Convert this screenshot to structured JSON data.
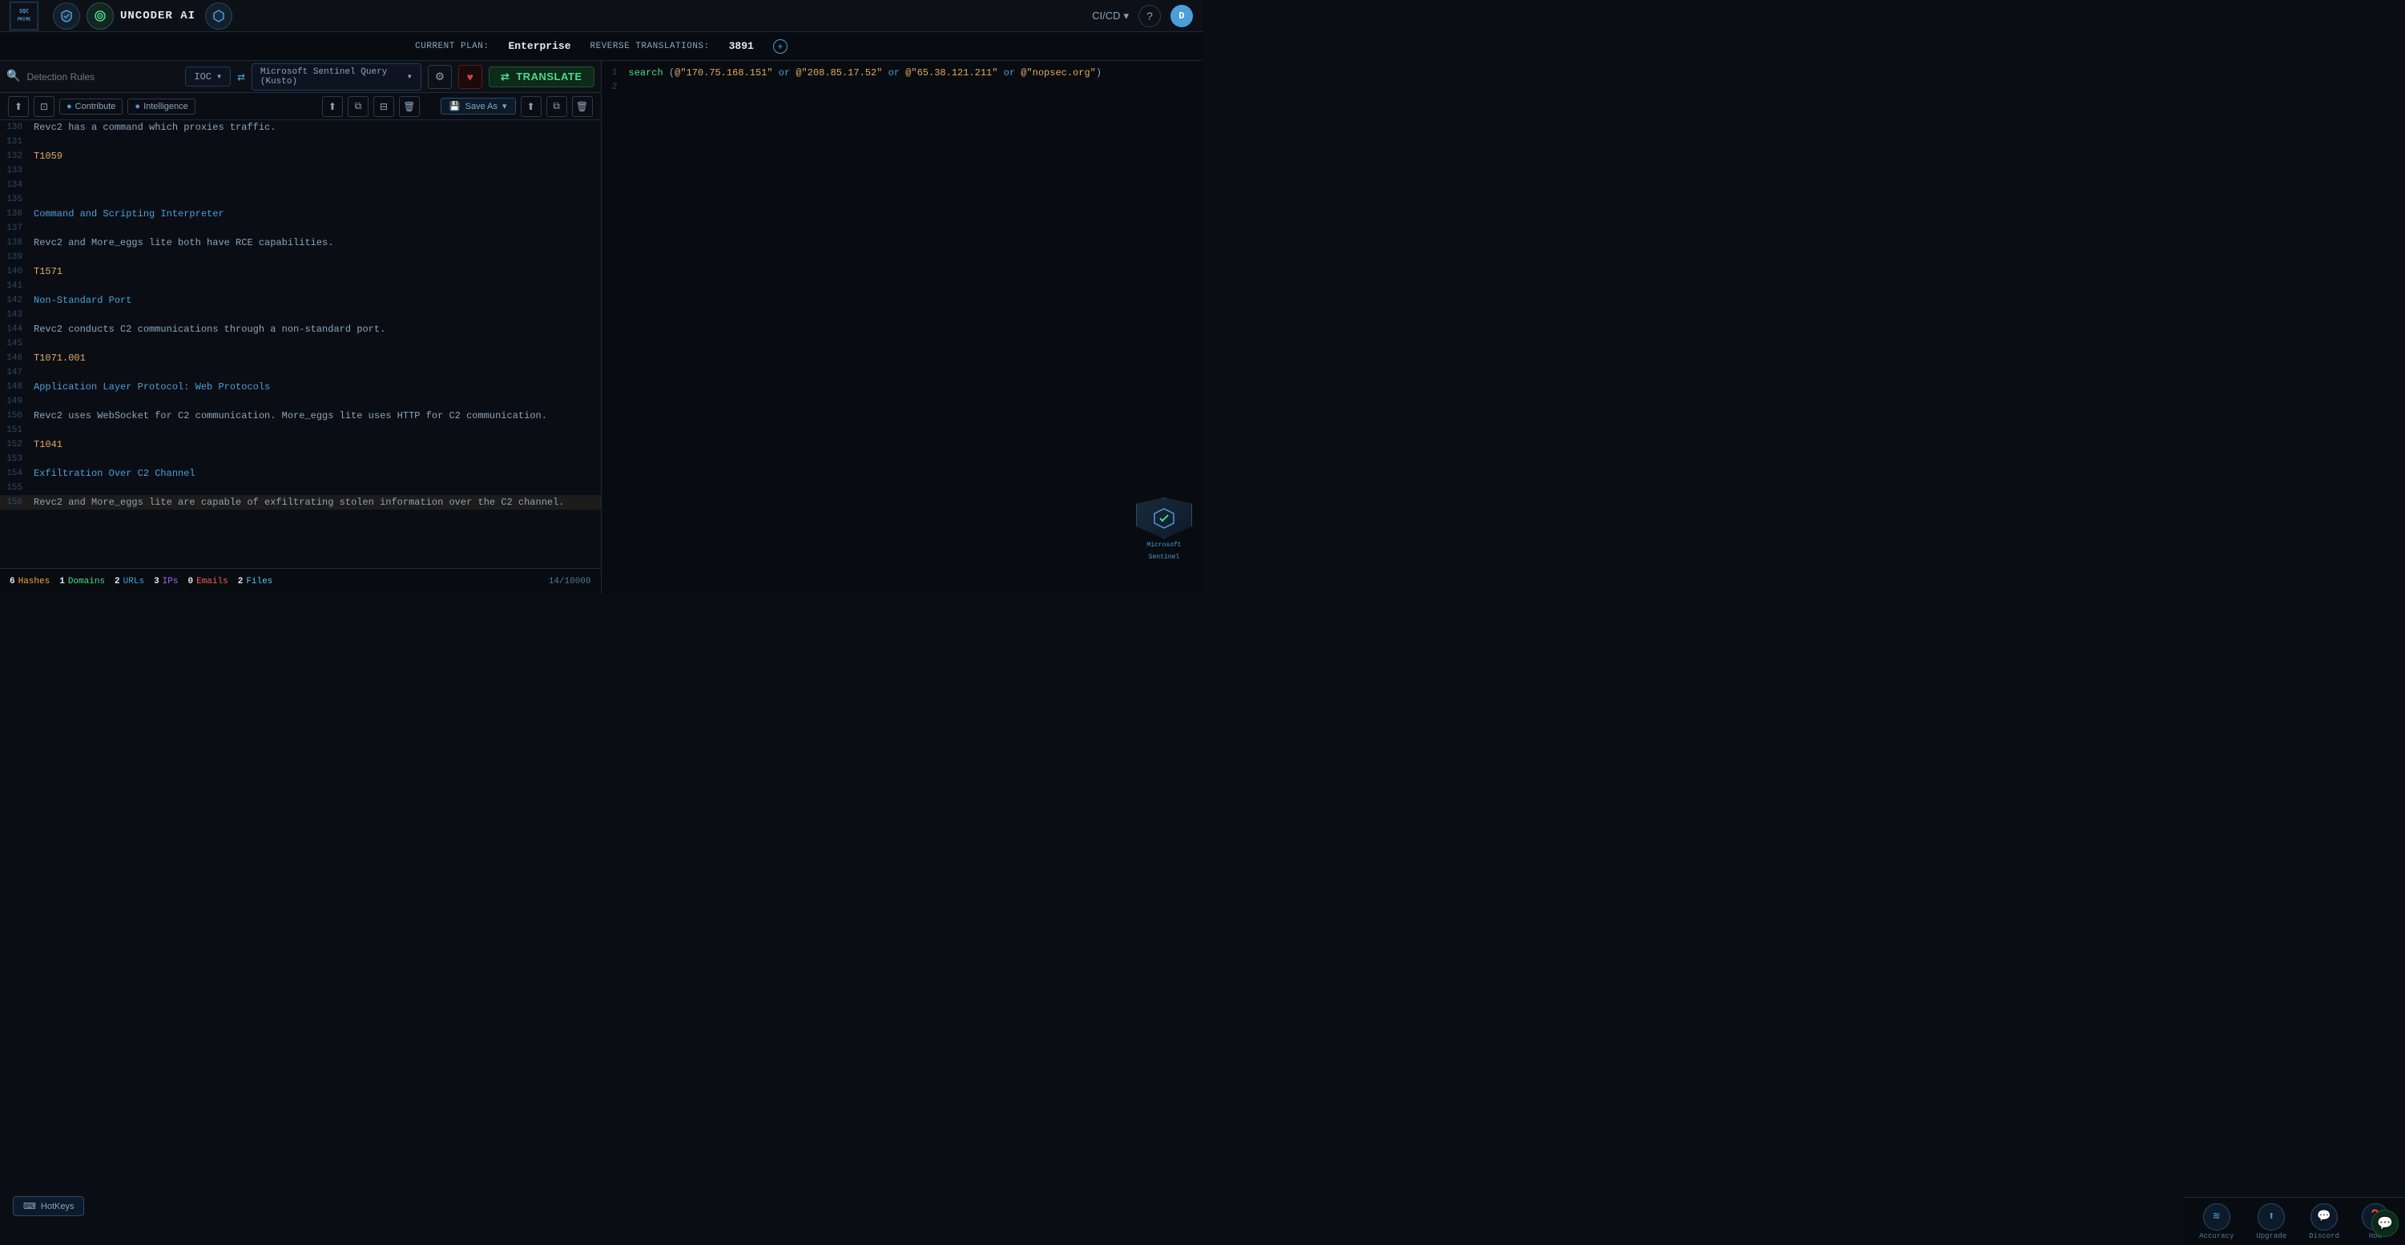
{
  "app": {
    "logo_text": "SQC\nPRIME",
    "title": "UNCODER AI"
  },
  "nav": {
    "cicd_label": "CI/CD",
    "help_icon": "?",
    "user_initial": "D"
  },
  "plan_bar": {
    "current_plan_label": "CURRENT PLAN:",
    "plan_value": "Enterprise",
    "reverse_label": "REVERSE TRANSLATIONS:",
    "translations_count": "3891"
  },
  "left_panel": {
    "search_placeholder": "Detection Rules",
    "ioc_label": "IOC",
    "toolbar": {
      "upload_icon": "⬆",
      "image_icon": "⊡",
      "contribute_label": "Contribute",
      "intelligence_label": "Intelligence",
      "copy_icon": "⧉",
      "filter_icon": "⊟",
      "delete_icon": "🗑"
    },
    "code_lines": [
      {
        "num": "130",
        "content": "Revc2 has a command which proxies traffic.",
        "type": "normal"
      },
      {
        "num": "131",
        "content": "",
        "type": "normal"
      },
      {
        "num": "132",
        "content": "T1059",
        "type": "label"
      },
      {
        "num": "133",
        "content": "",
        "type": "normal"
      },
      {
        "num": "134",
        "content": "",
        "type": "normal"
      },
      {
        "num": "135",
        "content": "",
        "type": "normal"
      },
      {
        "num": "136",
        "content": "Command and Scripting Interpreter",
        "type": "keyword"
      },
      {
        "num": "137",
        "content": "",
        "type": "normal"
      },
      {
        "num": "138",
        "content": "Revc2 and More_eggs lite both have RCE capabilities.",
        "type": "normal"
      },
      {
        "num": "139",
        "content": "",
        "type": "normal"
      },
      {
        "num": "140",
        "content": "T1571",
        "type": "label"
      },
      {
        "num": "141",
        "content": "",
        "type": "normal"
      },
      {
        "num": "142",
        "content": "Non-Standard Port",
        "type": "keyword"
      },
      {
        "num": "143",
        "content": "",
        "type": "normal"
      },
      {
        "num": "144",
        "content": "Revc2 conducts C2 communications through a non-standard port.",
        "type": "normal"
      },
      {
        "num": "145",
        "content": "",
        "type": "normal"
      },
      {
        "num": "146",
        "content": "T1071.001",
        "type": "label"
      },
      {
        "num": "147",
        "content": "",
        "type": "normal"
      },
      {
        "num": "148",
        "content": "Application Layer Protocol: Web Protocols",
        "type": "keyword"
      },
      {
        "num": "149",
        "content": "",
        "type": "normal"
      },
      {
        "num": "150",
        "content": "Revc2 uses WebSocket for C2 communication. More_eggs lite uses HTTP for C2 communication.",
        "type": "normal"
      },
      {
        "num": "151",
        "content": "",
        "type": "normal"
      },
      {
        "num": "152",
        "content": "T1041",
        "type": "label"
      },
      {
        "num": "153",
        "content": "",
        "type": "normal"
      },
      {
        "num": "154",
        "content": "Exfiltration Over C2 Channel",
        "type": "keyword"
      },
      {
        "num": "155",
        "content": "",
        "type": "normal"
      },
      {
        "num": "156",
        "content": "Revc2 and More_eggs lite are capable of exfiltrating stolen information over the C2 channel.",
        "type": "highlight"
      }
    ],
    "bottom_stats": {
      "hashes_count": "6",
      "hashes_label": "Hashes",
      "domains_count": "1",
      "domains_label": "Domains",
      "urls_count": "2",
      "urls_label": "URLs",
      "ips_count": "3",
      "ips_label": "IPs",
      "emails_count": "0",
      "emails_label": "Emails",
      "files_count": "2",
      "files_label": "Files",
      "char_count": "14/10000"
    }
  },
  "right_panel": {
    "query_engine_label": "Microsoft Sentinel Query (Kusto)",
    "settings_icon": "⚙",
    "fav_icon": "♥",
    "translate_icon": "⇄",
    "translate_label": "TRANSLATE",
    "save_as_label": "Save As",
    "save_icon": "💾",
    "copy_icon": "⧉",
    "delete_icon": "🗑",
    "query_lines": [
      {
        "num": "1",
        "content": "search (@\"170.75.168.151\" or @\"208.85.17.52\" or @\"65.38.121.211\" or @\"nopsec.org\")",
        "type": "query"
      },
      {
        "num": "2",
        "content": "",
        "type": "normal"
      }
    ],
    "sentinel_badge": {
      "shield_icon": "🛡",
      "text_line1": "Microsoft",
      "text_line2": "Sentinel"
    }
  },
  "hotkeys": {
    "label": "HotKeys",
    "icon": "⌨"
  },
  "bottom_icons": [
    {
      "icon": "≋",
      "label": "Accuracy"
    },
    {
      "icon": "⬆",
      "label": "Upgrade"
    },
    {
      "icon": "💬",
      "label": "Discord"
    },
    {
      "icon": "❓",
      "label": "How"
    }
  ],
  "chat_icon": "💬"
}
